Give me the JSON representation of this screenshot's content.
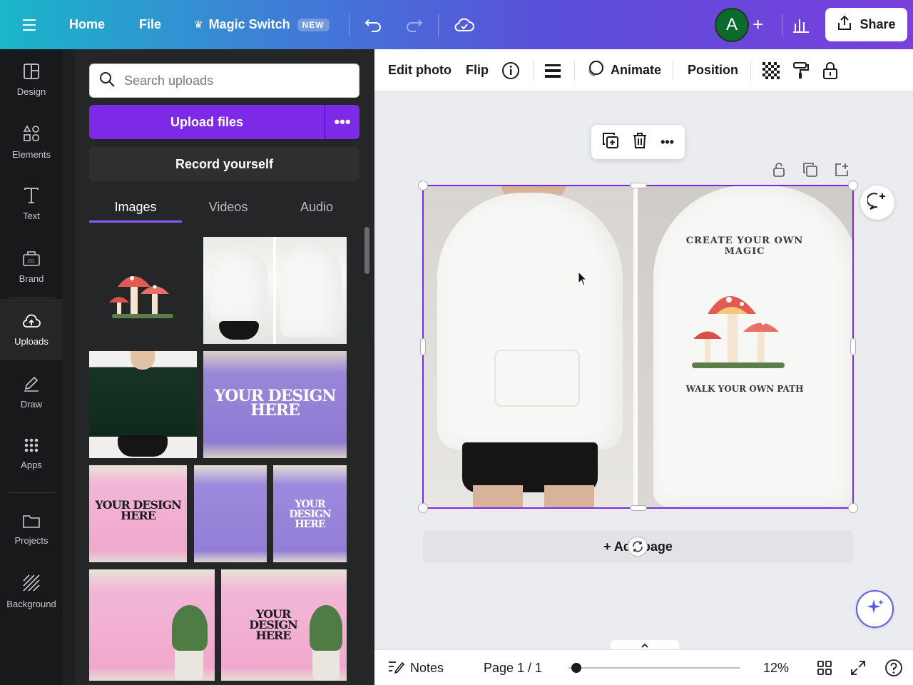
{
  "topbar": {
    "home": "Home",
    "file": "File",
    "magic_switch": "Magic Switch",
    "new_badge": "NEW",
    "avatar_letter": "A",
    "share": "Share"
  },
  "rail": [
    {
      "label": "Design",
      "icon": "layout-icon"
    },
    {
      "label": "Elements",
      "icon": "shapes-icon"
    },
    {
      "label": "Text",
      "icon": "text-icon"
    },
    {
      "label": "Brand",
      "icon": "brand-icon"
    },
    {
      "label": "Uploads",
      "icon": "upload-cloud-icon"
    },
    {
      "label": "Draw",
      "icon": "pen-icon"
    },
    {
      "label": "Apps",
      "icon": "grid-icon"
    },
    {
      "label": "Projects",
      "icon": "folder-icon"
    },
    {
      "label": "Background",
      "icon": "hatch-icon"
    }
  ],
  "panel": {
    "search_placeholder": "Search uploads",
    "upload_files": "Upload files",
    "record_yourself": "Record yourself",
    "tabs": [
      "Images",
      "Videos",
      "Audio"
    ],
    "active_tab": "Images",
    "thumb_texts": {
      "purple_tee": "YOUR DESIGN HERE",
      "pink_tee": "YOUR DESIGN HERE",
      "lav_tee": "YOUR DESIGN HERE",
      "pink_tee_2": "YOUR DESIGN HERE"
    }
  },
  "toolbar": {
    "edit_photo": "Edit photo",
    "flip": "Flip",
    "animate": "Animate",
    "position": "Position"
  },
  "canvas": {
    "add_page": "+ Add page",
    "graphic_top": "CREATE YOUR OWN MAGIC",
    "graphic_bottom": "WALK YOUR OWN PATH"
  },
  "bottombar": {
    "notes": "Notes",
    "page": "Page 1 / 1",
    "zoom": "12%"
  },
  "colors": {
    "accent": "#7d2ae8",
    "rail_bg": "#18191b",
    "panel_bg": "#252627"
  }
}
